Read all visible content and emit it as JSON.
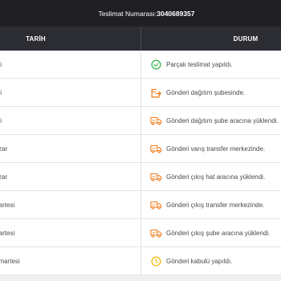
{
  "header": {
    "label": "Teslimat Numarası:",
    "number": "3040689357"
  },
  "table": {
    "columns": [
      "TARİH",
      "DURUM"
    ],
    "rows": [
      {
        "date": "ali",
        "icon": "check-circle-icon",
        "status": "Parçalı teslimat yapıldı."
      },
      {
        "date": "ali",
        "icon": "box-arrow-icon",
        "status": "Gönderi dağıtım şubesinde."
      },
      {
        "date": "ali",
        "icon": "truck-icon",
        "status": "Gönderi dağıtım şube aracına yüklendi."
      },
      {
        "date": "zar",
        "icon": "truck-icon",
        "status": "Gönderi varış transfer merkezinde."
      },
      {
        "date": "zar",
        "icon": "truck-icon",
        "status": "Gönderi çıkış hat aracına yüklendi."
      },
      {
        "date": "martesi",
        "icon": "truck-icon",
        "status": "Gönderi çıkış transfer merkezinde."
      },
      {
        "date": "martesi",
        "icon": "truck-icon",
        "status": "Gönderi çıkış şube aracına yüklendi."
      },
      {
        "date": "umartesi",
        "icon": "clock-circle-icon",
        "status": "Gönderi kabulü yapıldı."
      }
    ]
  },
  "colors": {
    "header_bg": "#1f1f24",
    "column_header_bg": "#2c2c33",
    "success": "#2fb24c",
    "orange": "#f07a1a",
    "pending": "#f2b705"
  }
}
